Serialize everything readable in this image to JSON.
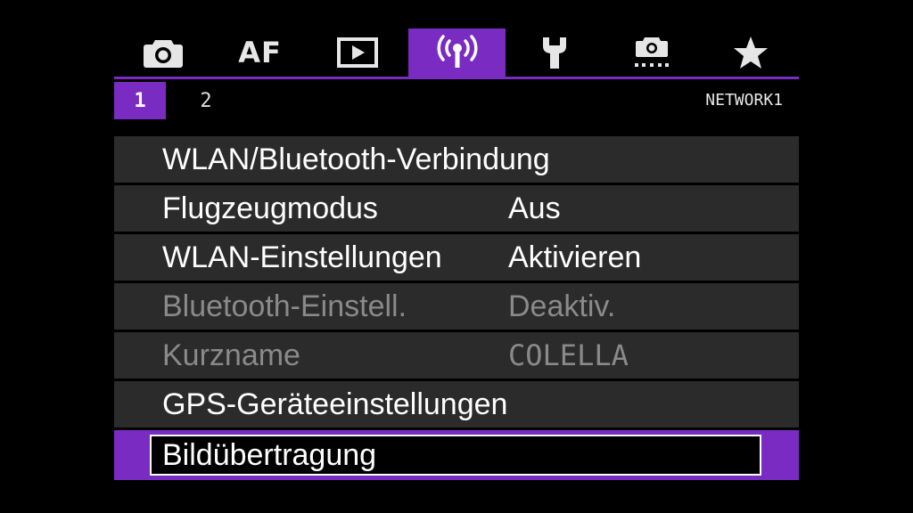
{
  "tabs": [
    {
      "name": "camera",
      "icon": "camera-icon"
    },
    {
      "name": "af",
      "label": "AF"
    },
    {
      "name": "playback",
      "icon": "play-icon"
    },
    {
      "name": "network",
      "icon": "wireless-icon",
      "active": true
    },
    {
      "name": "setup",
      "icon": "wrench-icon"
    },
    {
      "name": "custom",
      "icon": "custom-function-icon"
    },
    {
      "name": "my-menu",
      "icon": "star-icon"
    }
  ],
  "subtabs": [
    "1",
    "2"
  ],
  "section_name": "NETWORK1",
  "menu": [
    {
      "label": "WLAN/Bluetooth-Verbindung",
      "value": "",
      "enabled": true
    },
    {
      "label": "Flugzeugmodus",
      "value": "Aus",
      "enabled": true
    },
    {
      "label": "WLAN-Einstellungen",
      "value": "Aktivieren",
      "enabled": true
    },
    {
      "label": "Bluetooth-Einstell.",
      "value": "Deaktiv.",
      "enabled": false
    },
    {
      "label": "Kurzname",
      "value": "COLELLA",
      "enabled": false
    },
    {
      "label": "GPS-Geräteeinstellungen",
      "value": "",
      "enabled": true
    },
    {
      "label": "Bildübertragung",
      "value": "",
      "enabled": true,
      "selected": true
    }
  ],
  "colors": {
    "accent": "#7a2bc2",
    "row_bg": "#2b2b2b",
    "disabled_text": "#8a8a8a"
  }
}
